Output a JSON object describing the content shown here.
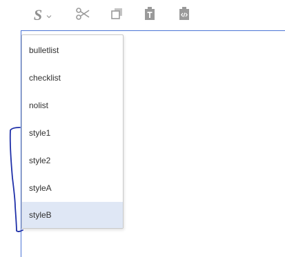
{
  "toolbar": {
    "style_button": {
      "glyph": "S",
      "icon": "styles-icon",
      "caret_icon": "chevron-down-icon"
    },
    "cut_icon": "scissors-icon",
    "copy_icon": "copy-icon",
    "paste_text_icon": "paste-as-text-icon",
    "paste_html_icon": "paste-as-html-icon"
  },
  "style_menu": {
    "items": [
      {
        "label": "bulletlist",
        "selected": false
      },
      {
        "label": "checklist",
        "selected": false
      },
      {
        "label": "nolist",
        "selected": false
      },
      {
        "label": "style1",
        "selected": false
      },
      {
        "label": "style2",
        "selected": false
      },
      {
        "label": "styleA",
        "selected": false
      },
      {
        "label": "styleB",
        "selected": true
      }
    ],
    "selected_bg": "#dfe7f5"
  },
  "colors": {
    "editor_border": "#4b74d6",
    "annotation_ink": "#1e2fa8",
    "icon_gray": "#9a9a9a"
  }
}
